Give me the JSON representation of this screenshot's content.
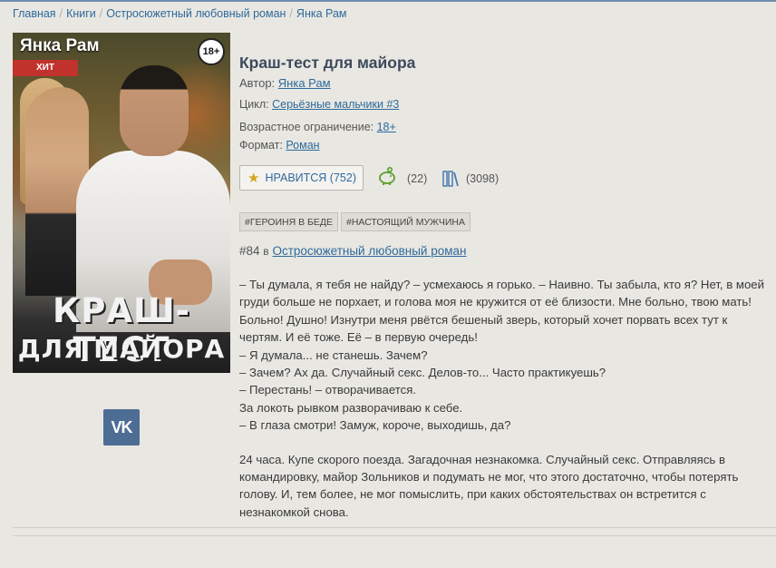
{
  "breadcrumb": [
    "Главная",
    "Книги",
    "Остросюжетный любовный роман",
    "Янка Рам"
  ],
  "cover": {
    "author": "Янка Рам",
    "badge": "ХИТ",
    "age": "18+",
    "title_line1": "КРАШ-ТЕСТ",
    "title_line2": "ДЛЯ МАЙОРА"
  },
  "social": {
    "vk_label": "VK"
  },
  "book": {
    "title": "Краш-тест для майора",
    "author_label": "Автор:",
    "author": "Янка Рам",
    "cycle_label": "Цикл:",
    "cycle": "Серьёзные мальчики #3",
    "age_label": "Возрастное ограничение:",
    "age": "18+",
    "format_label": "Формат:",
    "format": "Роман"
  },
  "actions": {
    "like_label": "НРАВИТСЯ (752)",
    "piggy_count": "(22)",
    "library_count": "(3098)"
  },
  "tags": [
    "#ГЕРОИНЯ В БЕДЕ",
    "#НАСТОЯЩИЙ МУЖЧИНА"
  ],
  "rank": {
    "position": "#84",
    "in": "в",
    "genre": "Остросюжетный любовный роман"
  },
  "description": [
    "– Ты думала, я тебя не найду? – усмехаюсь я горько. – Наивно. Ты забыла, кто я? Нет, в моей груди больше не порхает, и голова моя не кружится от её близости. Мне больно, твою мать! Больно! Душно! Изнутри меня рвётся бешеный зверь, который хочет порвать всех тут к чертям. И её тоже. Её – в первую очередь!",
    "– Я думала... не станешь. Зачем?",
    "– Зачем? Ах да. Случайный секс. Делов-то... Часто практикуешь?",
    "– Перестань! – отворачивается.",
    "За локоть рывком разворачиваю к себе.",
    "– В глаза смотри! Замуж, короче, выходишь, да?",
    "",
    "24 часа. Купе скорого поезда. Загадочная незнакомка. Случайный секс. Отправляясь в командировку, майор Зольников и подумать не мог, что этого достаточно, чтобы потерять голову. И, тем более, не мог помыслить, при каких обстоятельствах он встретится с незнакомкой снова."
  ],
  "colors": {
    "link": "#2f6a9b",
    "background": "#e8e7e2",
    "vk": "#4e6d95",
    "hit_badge": "#c0322b",
    "star": "#d3a61e"
  }
}
